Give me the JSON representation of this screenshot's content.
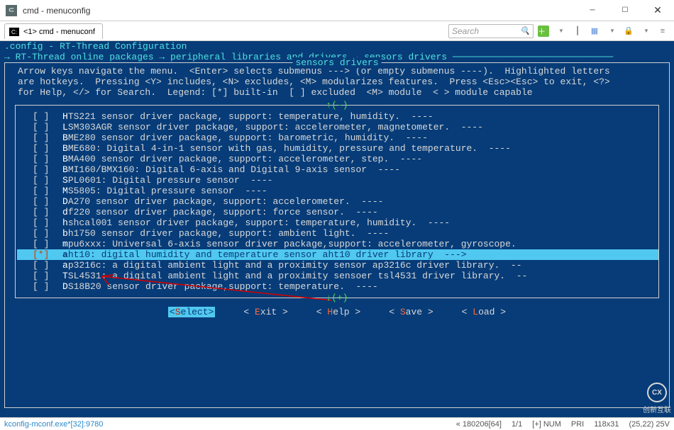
{
  "titlebar": {
    "title": "cmd - menuconfig"
  },
  "tab": {
    "label": "<1> cmd - menuconf"
  },
  "search": {
    "placeholder": "Search"
  },
  "config": {
    "header": ".config - RT-Thread Configuration",
    "breadcrumb": "→ RT-Thread online packages → peripheral libraries and drivers → sensors drivers ─────────────────────────────",
    "frame_title": "sensors drivers",
    "help": "Arrow keys navigate the menu.  <Enter> selects submenus ---> (or empty submenus ----).  Highlighted letters\nare hotkeys.  Pressing <Y> includes, <N> excludes, <M> modularizes features.  Press <Esc><Esc> to exit, <?>\nfor Help, </> for Search.  Legend: [*] built-in  [ ] excluded  <M> module  < > module capable",
    "scroll_top": "↑(-)",
    "scroll_bot": "↓(+)"
  },
  "items": [
    {
      "sel": false,
      "mark": "[ ]",
      "hk": "H",
      "rest": "TS221 sensor driver package, support: temperature, humidity.  ----"
    },
    {
      "sel": false,
      "mark": "[ ]",
      "hk": "L",
      "rest": "SM303AGR sensor driver package, support: accelerometer, magnetometer.  ----"
    },
    {
      "sel": false,
      "mark": "[ ]",
      "hk": "B",
      "rest": "ME280 sensor driver package, support: barometric, humidity.  ----"
    },
    {
      "sel": false,
      "mark": "[ ]",
      "hk": "B",
      "rest": "ME680: Digital 4-in-1 sensor with gas, humidity, pressure and temperature.  ----"
    },
    {
      "sel": false,
      "mark": "[ ]",
      "hk": "B",
      "rest": "MA400 sensor driver package, support: accelerometer, step.  ----"
    },
    {
      "sel": false,
      "mark": "[ ]",
      "hk": "B",
      "rest": "MI160/BMX160: Digital 6-axis and Digital 9-axis sensor  ----"
    },
    {
      "sel": false,
      "mark": "[ ]",
      "hk": "S",
      "rest": "PL0601: Digital pressure sensor  ----"
    },
    {
      "sel": false,
      "mark": "[ ]",
      "hk": "M",
      "rest": "S5805: Digital pressure sensor  ----"
    },
    {
      "sel": false,
      "mark": "[ ]",
      "hk": "D",
      "rest": "A270 sensor driver package, support: accelerometer.  ----"
    },
    {
      "sel": false,
      "mark": "[ ]",
      "hk": "d",
      "rest": "f220 sensor driver package, support: force sensor.  ----"
    },
    {
      "sel": false,
      "mark": "[ ]",
      "hk": "h",
      "rest": "shcal001 sensor driver package, support: temperature, humidity.  ----"
    },
    {
      "sel": false,
      "mark": "[ ]",
      "hk": "b",
      "rest": "h1750 sensor driver package, support: ambient light.  ----"
    },
    {
      "sel": false,
      "mark": "[ ]",
      "hk": "m",
      "rest": "pu6xxx: Universal 6-axis sensor driver package,support: accelerometer, gyroscope."
    },
    {
      "sel": true,
      "mark": "[*]",
      "hk": "a",
      "rest": "ht10: digital humidity and temperature sensor aht10 driver library  --->"
    },
    {
      "sel": false,
      "mark": "[ ]",
      "hk": "a",
      "rest": "p3216c: a digital ambient light and a proximity sensor ap3216c driver library.  --"
    },
    {
      "sel": false,
      "mark": "[ ]",
      "hk": "T",
      "rest": "SL4531: a digital ambient light and a proximity sensoer tsl4531 driver library.  --"
    },
    {
      "sel": false,
      "mark": "[ ]",
      "hk": "D",
      "rest": "S18B20 sensor driver package,support: temperature.  ----"
    }
  ],
  "buttons": {
    "select": "Select",
    "exit": "Exit",
    "help": "Help",
    "save": "Save",
    "load": "Load"
  },
  "status": {
    "proc": "kconfig-mconf.exe*[32]:9780",
    "enc": "« 180206[64]",
    "pos": "1/1",
    "caps": "[+] NUM",
    "pri": "PRI",
    "size": "118x31",
    "cursor": "(25,22) 25V"
  },
  "watermark": "创新互联"
}
